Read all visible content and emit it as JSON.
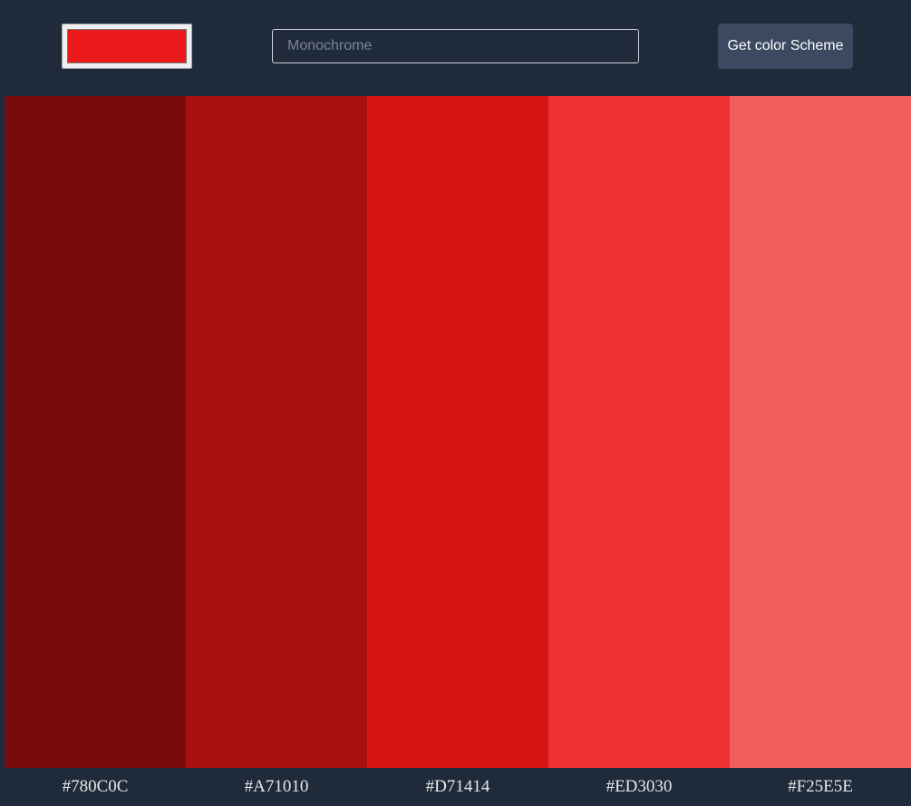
{
  "header": {
    "seed_color": "#EC1A1A",
    "mode_placeholder": "Monochrome",
    "mode_value": "",
    "button_label": "Get color Scheme"
  },
  "palette": {
    "colors": [
      {
        "hex": "#780C0C",
        "label": "#780C0C"
      },
      {
        "hex": "#A71010",
        "label": "#A71010"
      },
      {
        "hex": "#D71414",
        "label": "#D71414"
      },
      {
        "hex": "#ED3030",
        "label": "#ED3030"
      },
      {
        "hex": "#F25E5E",
        "label": "#F25E5E"
      }
    ]
  }
}
